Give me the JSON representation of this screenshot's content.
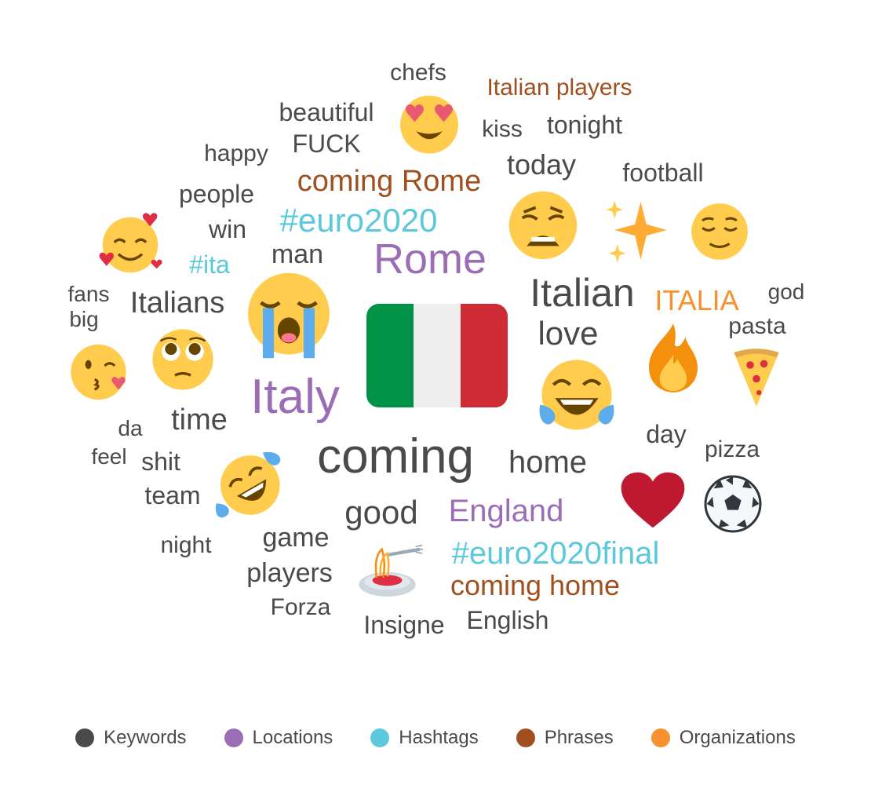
{
  "colors": {
    "Keywords": "#4a4a4a",
    "Locations": "#9b6db5",
    "Hashtags": "#5bc8dc",
    "Phrases": "#a0501f",
    "Organizations": "#f7902e"
  },
  "words": [
    {
      "text": "chefs",
      "category": "Keywords"
    },
    {
      "text": "Italian players",
      "category": "Phrases"
    },
    {
      "text": "beautiful",
      "category": "Keywords"
    },
    {
      "text": "FUCK",
      "category": "Keywords"
    },
    {
      "text": "kiss",
      "category": "Keywords"
    },
    {
      "text": "tonight",
      "category": "Keywords"
    },
    {
      "text": "happy",
      "category": "Keywords"
    },
    {
      "text": "coming Rome",
      "category": "Phrases"
    },
    {
      "text": "today",
      "category": "Keywords"
    },
    {
      "text": "football",
      "category": "Keywords"
    },
    {
      "text": "people",
      "category": "Keywords"
    },
    {
      "text": "#euro2020",
      "category": "Hashtags"
    },
    {
      "text": "win",
      "category": "Keywords"
    },
    {
      "text": "Rome",
      "category": "Locations"
    },
    {
      "text": "#ita",
      "category": "Hashtags"
    },
    {
      "text": "man",
      "category": "Keywords"
    },
    {
      "text": "fans",
      "category": "Keywords"
    },
    {
      "text": "big",
      "category": "Keywords"
    },
    {
      "text": "Italians",
      "category": "Keywords"
    },
    {
      "text": "Italian",
      "category": "Keywords"
    },
    {
      "text": "ITALIA",
      "category": "Organizations"
    },
    {
      "text": "god",
      "category": "Keywords"
    },
    {
      "text": "pasta",
      "category": "Keywords"
    },
    {
      "text": "love",
      "category": "Keywords"
    },
    {
      "text": "Italy",
      "category": "Locations"
    },
    {
      "text": "da",
      "category": "Keywords"
    },
    {
      "text": "time",
      "category": "Keywords"
    },
    {
      "text": "day",
      "category": "Keywords"
    },
    {
      "text": "feel",
      "category": "Keywords"
    },
    {
      "text": "shit",
      "category": "Keywords"
    },
    {
      "text": "coming",
      "category": "Keywords"
    },
    {
      "text": "home",
      "category": "Keywords"
    },
    {
      "text": "pizza",
      "category": "Keywords"
    },
    {
      "text": "team",
      "category": "Keywords"
    },
    {
      "text": "good",
      "category": "Keywords"
    },
    {
      "text": "England",
      "category": "Locations"
    },
    {
      "text": "night",
      "category": "Keywords"
    },
    {
      "text": "game",
      "category": "Keywords"
    },
    {
      "text": "#euro2020final",
      "category": "Hashtags"
    },
    {
      "text": "players",
      "category": "Keywords"
    },
    {
      "text": "coming home",
      "category": "Phrases"
    },
    {
      "text": "Forza",
      "category": "Keywords"
    },
    {
      "text": "Insigne",
      "category": "Keywords"
    },
    {
      "text": "English",
      "category": "Keywords"
    }
  ],
  "emojis": [
    {
      "icon": "heart-eyes-emoji-icon"
    },
    {
      "icon": "weary-face-emoji-icon"
    },
    {
      "icon": "sparkles-emoji-icon"
    },
    {
      "icon": "relieved-face-emoji-icon"
    },
    {
      "icon": "smiling-hearts-emoji-icon"
    },
    {
      "icon": "crying-face-emoji-icon"
    },
    {
      "icon": "italy-flag-icon"
    },
    {
      "icon": "fire-emoji-icon"
    },
    {
      "icon": "pizza-emoji-icon"
    },
    {
      "icon": "kissing-face-emoji-icon"
    },
    {
      "icon": "pleading-face-emoji-icon"
    },
    {
      "icon": "joy-emoji-icon"
    },
    {
      "icon": "rofl-emoji-icon"
    },
    {
      "icon": "red-heart-emoji-icon"
    },
    {
      "icon": "soccer-ball-emoji-icon"
    },
    {
      "icon": "spaghetti-emoji-icon"
    }
  ],
  "legend": [
    {
      "label": "Keywords",
      "color": "#4a4a4a"
    },
    {
      "label": "Locations",
      "color": "#9b6db5"
    },
    {
      "label": "Hashtags",
      "color": "#5bc8dc"
    },
    {
      "label": "Phrases",
      "color": "#a0501f"
    },
    {
      "label": "Organizations",
      "color": "#f7902e"
    }
  ]
}
